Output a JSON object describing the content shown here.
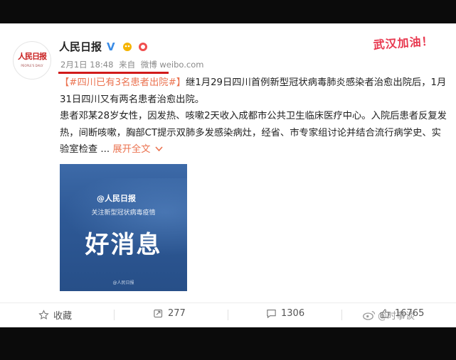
{
  "post": {
    "author": "人民日报",
    "meta_date": "2月1日 18:48",
    "meta_from": "来自",
    "meta_source": "微博 weibo.com",
    "avatar_text": "人民日报",
    "avatar_sub": "PEOPLE'S DAILY",
    "sticker": "武汉加油！",
    "hashtag": "【#四川已有3名患者出院#】",
    "line1_rest": "继1月29日四川首例新型冠状病毒肺炎感染者治愈出院后，1月31日四川又有两名患者治愈出院。",
    "line2": "患者邓某28岁女性，因发热、咳嗽2天收入成都市公共卫生临床医疗中心。入院后患者反复发热，间断咳嗽，胸部CT提示双肺多发感染病灶，经省、市专家组讨论并结合流行病学史、实验室检查 ...",
    "expand": "展开全文",
    "expand_icon": "chevron-down-icon"
  },
  "image": {
    "logo": "@人民日报",
    "subtitle": "关注新型冠状病毒疫情",
    "title": "好消息",
    "footer": "@人民日报"
  },
  "actions": {
    "favorite_label": "收藏",
    "repost_count": "277",
    "comment_count": "1306",
    "like_count": "16765"
  },
  "watermark": "@时事谈",
  "colors": {
    "accent_orange": "#eb7350",
    "underline_red": "#d11a1a",
    "sticker_pink": "#e8384f"
  }
}
